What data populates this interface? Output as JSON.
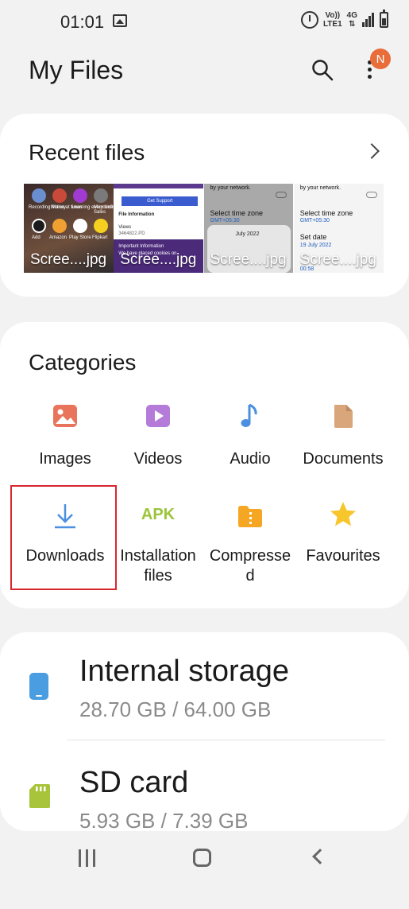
{
  "status_bar": {
    "time": "01:01",
    "volte_line1": "Vo))",
    "volte_line2": "LTE1",
    "network": "4G"
  },
  "header": {
    "title": "My Files",
    "avatar_initial": "N",
    "avatar_color": "#e96d3a"
  },
  "recent": {
    "title": "Recent files",
    "files": [
      {
        "label": "Scree....jpg"
      },
      {
        "label": "Scree....jpg"
      },
      {
        "label": "Scree....jpg"
      },
      {
        "label": "Scree....jpg"
      }
    ],
    "thumb1": {
      "apps": [
        "Recording Money",
        "Notice at times",
        "Learning every time",
        "Microsoft Sales",
        "Add",
        "Amazon",
        "Play Store",
        "Flipkart"
      ]
    },
    "thumb2": {
      "button": "Get Support",
      "heading": "File Information",
      "item": "Views",
      "item_value": "3464822.PD",
      "important": "Important Information",
      "note": "We have placed cookies on"
    },
    "thumb3": {
      "top": "by your network.",
      "label": "Select time zone",
      "value": "GMT+05:30",
      "month": "July 2022"
    },
    "thumb4": {
      "top": "by your network.",
      "label": "Select time zone",
      "value": "GMT+05:30",
      "date_label": "Set date",
      "date_value": "19 July 2022",
      "time_value": "00:58"
    }
  },
  "categories": {
    "title": "Categories",
    "items": [
      {
        "label": "Images",
        "icon": "image-icon",
        "color": "#e8745b"
      },
      {
        "label": "Videos",
        "icon": "video-icon",
        "color": "#b57bd9"
      },
      {
        "label": "Audio",
        "icon": "audio-icon",
        "color": "#4a8fe0"
      },
      {
        "label": "Documents",
        "icon": "document-icon",
        "color": "#d9a57a"
      },
      {
        "label": "Downloads",
        "icon": "download-icon",
        "color": "#4a8fe0"
      },
      {
        "label_line1": "Installation",
        "label_line2": "files",
        "icon_text": "APK",
        "icon": "apk-icon",
        "color": "#9bc43a"
      },
      {
        "label_line1": "Compresse",
        "label_line2": "d",
        "icon": "compressed-icon",
        "color": "#f5a623"
      },
      {
        "label": "Favourites",
        "icon": "star-icon",
        "color": "#f7c62c"
      }
    ]
  },
  "storage": {
    "items": [
      {
        "name": "Internal storage",
        "size": "28.70 GB / 64.00 GB",
        "icon": "phone-icon",
        "color": "#4a9de0"
      },
      {
        "name": "SD card",
        "size": "5.93 GB / 7.39 GB",
        "icon": "sd-card-icon",
        "color": "#a8c43a"
      }
    ]
  }
}
